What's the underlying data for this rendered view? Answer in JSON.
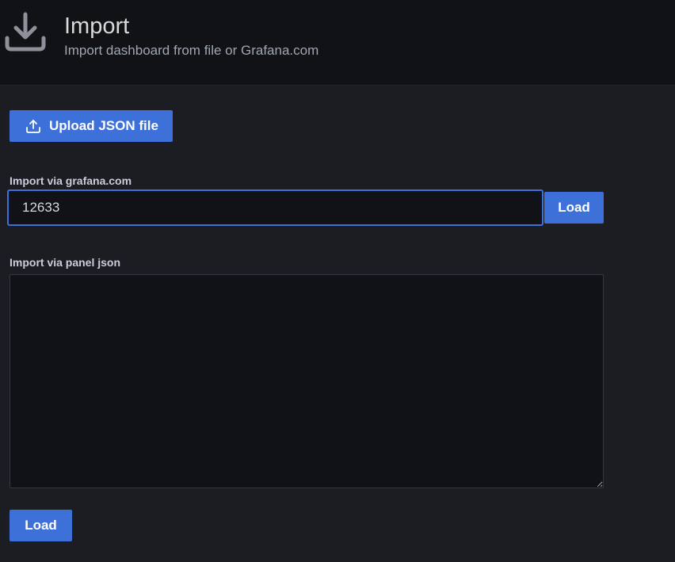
{
  "header": {
    "icon": "download-icon",
    "title": "Import",
    "subtitle": "Import dashboard from file or Grafana.com"
  },
  "upload": {
    "icon": "upload-icon",
    "label": "Upload JSON file"
  },
  "grafana_import": {
    "label": "Import via grafana.com",
    "value": "12633",
    "load_label": "Load"
  },
  "panel_json": {
    "label": "Import via panel json",
    "value": ""
  },
  "footer": {
    "load_label": "Load"
  },
  "colors": {
    "accent": "#3d71d9",
    "background": "#1b1d22",
    "header_background": "#111216",
    "input_background": "#111217"
  }
}
